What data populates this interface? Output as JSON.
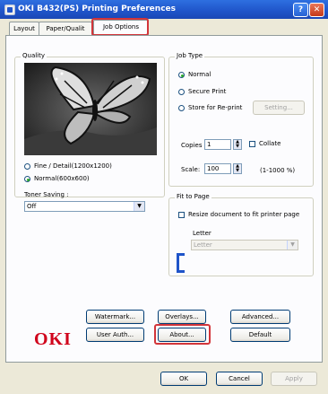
{
  "window": {
    "title": "OKI B432(PS) Printing Preferences",
    "help": "?",
    "close": "✕"
  },
  "tabs": [
    {
      "label": "Layout",
      "active": false
    },
    {
      "label": "Paper/Qualit",
      "active": false
    },
    {
      "label": "Job Options",
      "active": true
    }
  ],
  "quality": {
    "label": "Quality",
    "options": [
      {
        "label": "Fine / Detail(1200x1200)",
        "selected": false
      },
      {
        "label": "Normal(600x600)",
        "selected": true
      }
    ]
  },
  "toner_saving": {
    "label": "Toner Saving :",
    "value": "Off"
  },
  "job_type": {
    "label": "Job Type",
    "options": [
      {
        "label": "Normal",
        "selected": true
      },
      {
        "label": "Secure Print",
        "selected": false
      },
      {
        "label": "Store for Re-print",
        "selected": false
      }
    ],
    "setting_button": "Setting..."
  },
  "copies": {
    "label": "Copies",
    "value": "1",
    "collate_label": "Collate",
    "collate_checked": false
  },
  "scale": {
    "label": "Scale:",
    "value": "100",
    "range": "(1-1000 %)"
  },
  "fit_to_page": {
    "label": "Fit to Page",
    "resize_label": "Resize document to fit printer page",
    "resize_checked": false,
    "paper_label": "Letter",
    "paper_value": "Letter"
  },
  "buttons": {
    "watermark": "Watermark...",
    "overlays": "Overlays...",
    "advanced": "Advanced...",
    "user_auth": "User Auth...",
    "about": "About...",
    "default": "Default"
  },
  "logo": "OKI",
  "footer": {
    "ok": "OK",
    "cancel": "Cancel",
    "apply": "Apply"
  },
  "colors": {
    "title_bar": "#1f54c9",
    "highlight": "#d2353a",
    "logo": "#d0021b"
  }
}
